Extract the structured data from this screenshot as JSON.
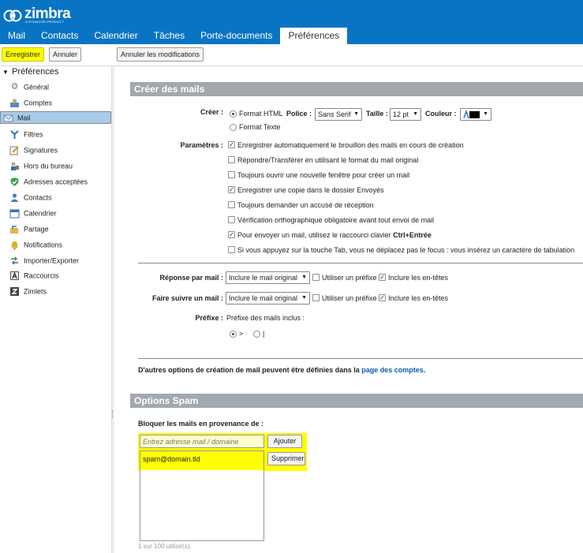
{
  "app": {
    "name": "zimbra",
    "tagline": "A SYNACOR PRODUCT"
  },
  "colors": {
    "header": "#0a74c4",
    "highlight": "#ffff00",
    "section": "#a3a8ad",
    "selected": "#a9cbea",
    "link": "#0a5ea8"
  },
  "tabs": [
    {
      "label": "Mail",
      "active": false
    },
    {
      "label": "Contacts",
      "active": false
    },
    {
      "label": "Calendrier",
      "active": false
    },
    {
      "label": "Tâches",
      "active": false
    },
    {
      "label": "Porte-documents",
      "active": false
    },
    {
      "label": "Préférences",
      "active": true
    }
  ],
  "toolbar": {
    "save": "Enregistrer",
    "cancel": "Annuler",
    "revert": "Annuler les modifications"
  },
  "sidebar": {
    "root": "Préférences",
    "items": [
      {
        "label": "Général",
        "icon": "gear-icon",
        "selected": false
      },
      {
        "label": "Comptes",
        "icon": "accounts-icon",
        "selected": false
      },
      {
        "label": "Mail",
        "icon": "mail-icon",
        "selected": true
      },
      {
        "label": "Filtres",
        "icon": "filter-icon",
        "selected": false
      },
      {
        "label": "Signatures",
        "icon": "signature-icon",
        "selected": false
      },
      {
        "label": "Hors du bureau",
        "icon": "out-of-office-icon",
        "selected": false
      },
      {
        "label": "Adresses acceptées",
        "icon": "shield-check-icon",
        "selected": false
      },
      {
        "label": "Contacts",
        "icon": "contacts-icon",
        "selected": false
      },
      {
        "label": "Calendrier",
        "icon": "calendar-icon",
        "selected": false
      },
      {
        "label": "Partage",
        "icon": "share-icon",
        "selected": false
      },
      {
        "label": "Notifications",
        "icon": "bell-icon",
        "selected": false
      },
      {
        "label": "Importer/Exporter",
        "icon": "import-export-icon",
        "selected": false
      },
      {
        "label": "Raccourcis",
        "icon": "shortcut-icon",
        "selected": false
      },
      {
        "label": "Zimlets",
        "icon": "zimlet-icon",
        "selected": false
      }
    ]
  },
  "compose": {
    "title": "Créer des mails",
    "create_label": "Créer :",
    "format_html": "Format HTML",
    "format_text": "Format Texte",
    "format_selected": "html",
    "font_label": "Police :",
    "font_value": "Sans Serif",
    "size_label": "Taille :",
    "size_value": "12 pt",
    "color_label": "Couleur :",
    "params_label": "Paramètres :",
    "options": [
      {
        "label": "Enregistrer automatiquement le brouillon des mails en cours de création",
        "checked": true
      },
      {
        "label": "Répondre/Transférer en utilisant le format du mail original",
        "checked": false
      },
      {
        "label": "Toujours ouvrir une nouvelle fenêtre pour créer un mail",
        "checked": false
      },
      {
        "label": "Enregistrer une copie dans le dossier Envoyés",
        "checked": true
      },
      {
        "label": "Toujours demander un accusé de réception",
        "checked": false
      },
      {
        "label": "Vérification orthographique obligatoire avant tout envoi de mail",
        "checked": false
      },
      {
        "label": "Pour envoyer un mail, utilisez le raccourci clavier",
        "bold_suffix": "Ctrl+Entrée",
        "checked": true
      },
      {
        "label": "Si vous appuyez sur la touche Tab, vous ne déplacez pas le focus : vous insérez un caractère de tabulation",
        "checked": false
      }
    ],
    "reply_label": "Réponse par mail :",
    "reply_value": "Inclure le mail original",
    "forward_label": "Faire suivre un mail :",
    "forward_value": "Inclure le mail original",
    "use_prefix": "Utiliser un préfixe",
    "include_headers": "Inclure les en-têtes",
    "reply_use_prefix": false,
    "reply_headers": true,
    "forward_use_prefix": false,
    "forward_headers": true,
    "prefix_label": "Préfixe :",
    "prefix_text": "Préfixe des mails inclus :",
    "prefix_option1": ">",
    "prefix_option2": "|",
    "prefix_selected": 1,
    "footer_text": "D'autres options de création de mail peuvent être définies dans la",
    "footer_link": "page des comptes",
    "footer_end": "."
  },
  "spam": {
    "title": "Options Spam",
    "block_label": "Bloquer les mails en provenance de :",
    "input_placeholder": "Entrez adresse mail / domaine",
    "add_button": "Ajouter",
    "remove_button": "Supprimer",
    "list": [
      "spam@domain.tld"
    ],
    "usage": "1 sur 100 utilisé(s)."
  }
}
